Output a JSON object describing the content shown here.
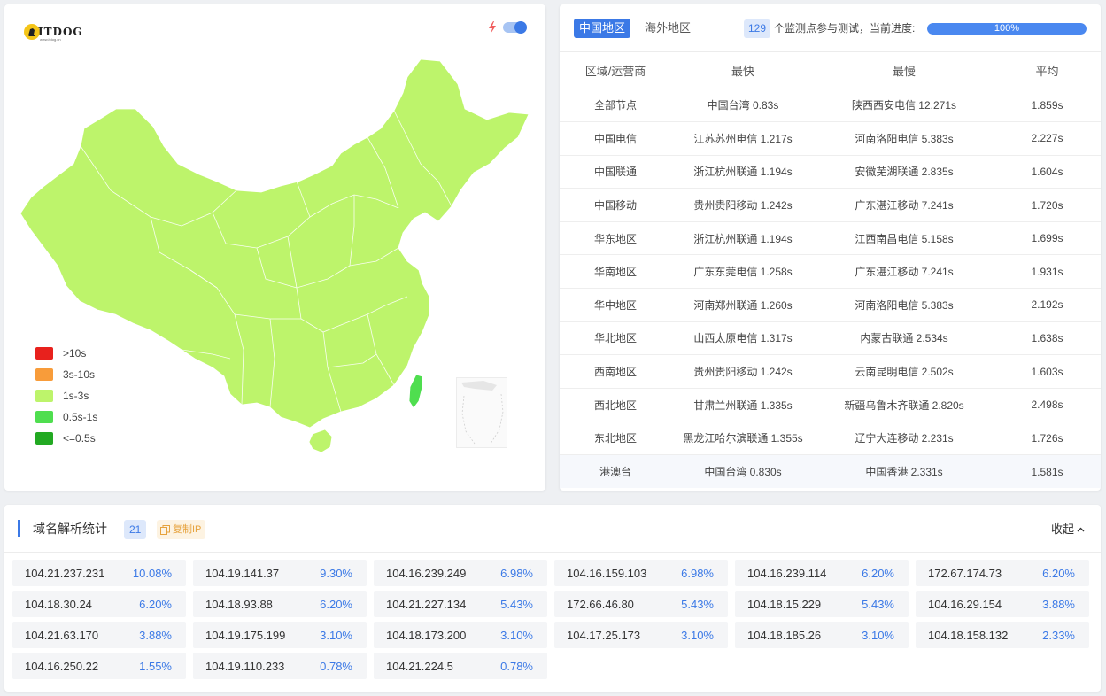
{
  "map_panel": {
    "logo_text": "ITDOG",
    "logo_sub": "www.itdog.cn",
    "legend": [
      {
        "label": ">10s",
        "color": "#e8211d"
      },
      {
        "label": "3s-10s",
        "color": "#f89c3a"
      },
      {
        "label": "1s-3s",
        "color": "#bdf46b"
      },
      {
        "label": "0.5s-1s",
        "color": "#4fde4f"
      },
      {
        "label": "<=0.5s",
        "color": "#22a922"
      }
    ],
    "map_fill_color": "#bdf46b",
    "switch_on": true
  },
  "stats_panel": {
    "tabs": [
      "中国地区",
      "海外地区"
    ],
    "active_tab": "中国地区",
    "probe_count": "129",
    "probe_text": "个监测点参与测试，当前进度:",
    "progress": {
      "value": 1.0,
      "label": "100%"
    },
    "columns": [
      "区域/运营商",
      "最快",
      "最慢",
      "平均"
    ],
    "rows": [
      [
        "全部节点",
        "中国台湾 0.83s",
        "陕西西安电信 12.271s",
        "1.859s"
      ],
      [
        "中国电信",
        "江苏苏州电信 1.217s",
        "河南洛阳电信 5.383s",
        "2.227s"
      ],
      [
        "中国联通",
        "浙江杭州联通 1.194s",
        "安徽芜湖联通 2.835s",
        "1.604s"
      ],
      [
        "中国移动",
        "贵州贵阳移动 1.242s",
        "广东湛江移动 7.241s",
        "1.720s"
      ],
      [
        "华东地区",
        "浙江杭州联通 1.194s",
        "江西南昌电信 5.158s",
        "1.699s"
      ],
      [
        "华南地区",
        "广东东莞电信 1.258s",
        "广东湛江移动 7.241s",
        "1.931s"
      ],
      [
        "华中地区",
        "河南郑州联通 1.260s",
        "河南洛阳电信 5.383s",
        "2.192s"
      ],
      [
        "华北地区",
        "山西太原电信 1.317s",
        "内蒙古联通 2.534s",
        "1.638s"
      ],
      [
        "西南地区",
        "贵州贵阳移动 1.242s",
        "云南昆明电信 2.502s",
        "1.603s"
      ],
      [
        "西北地区",
        "甘肃兰州联通 1.335s",
        "新疆乌鲁木齐联通 2.820s",
        "2.498s"
      ],
      [
        "东北地区",
        "黑龙江哈尔滨联通 1.355s",
        "辽宁大连移动 2.231s",
        "1.726s"
      ],
      [
        "港澳台",
        "中国台湾 0.830s",
        "中国香港 2.331s",
        "1.581s"
      ]
    ]
  },
  "dns_panel": {
    "title": "域名解析统计",
    "count": "21",
    "copy_label": "复制IP",
    "collapse_label": "收起",
    "ips": [
      {
        "ip": "104.21.237.231",
        "pct": "10.08%"
      },
      {
        "ip": "104.19.141.37",
        "pct": "9.30%"
      },
      {
        "ip": "104.16.239.249",
        "pct": "6.98%"
      },
      {
        "ip": "104.16.159.103",
        "pct": "6.98%"
      },
      {
        "ip": "104.16.239.114",
        "pct": "6.20%"
      },
      {
        "ip": "172.67.174.73",
        "pct": "6.20%"
      },
      {
        "ip": "104.18.30.24",
        "pct": "6.20%"
      },
      {
        "ip": "104.18.93.88",
        "pct": "6.20%"
      },
      {
        "ip": "104.21.227.134",
        "pct": "5.43%"
      },
      {
        "ip": "172.66.46.80",
        "pct": "5.43%"
      },
      {
        "ip": "104.18.15.229",
        "pct": "5.43%"
      },
      {
        "ip": "104.16.29.154",
        "pct": "3.88%"
      },
      {
        "ip": "104.21.63.170",
        "pct": "3.88%"
      },
      {
        "ip": "104.19.175.199",
        "pct": "3.10%"
      },
      {
        "ip": "104.18.173.200",
        "pct": "3.10%"
      },
      {
        "ip": "104.17.25.173",
        "pct": "3.10%"
      },
      {
        "ip": "104.18.185.26",
        "pct": "3.10%"
      },
      {
        "ip": "104.18.158.132",
        "pct": "2.33%"
      },
      {
        "ip": "104.16.250.22",
        "pct": "1.55%"
      },
      {
        "ip": "104.19.110.233",
        "pct": "0.78%"
      },
      {
        "ip": "104.21.224.5",
        "pct": "0.78%"
      }
    ]
  }
}
